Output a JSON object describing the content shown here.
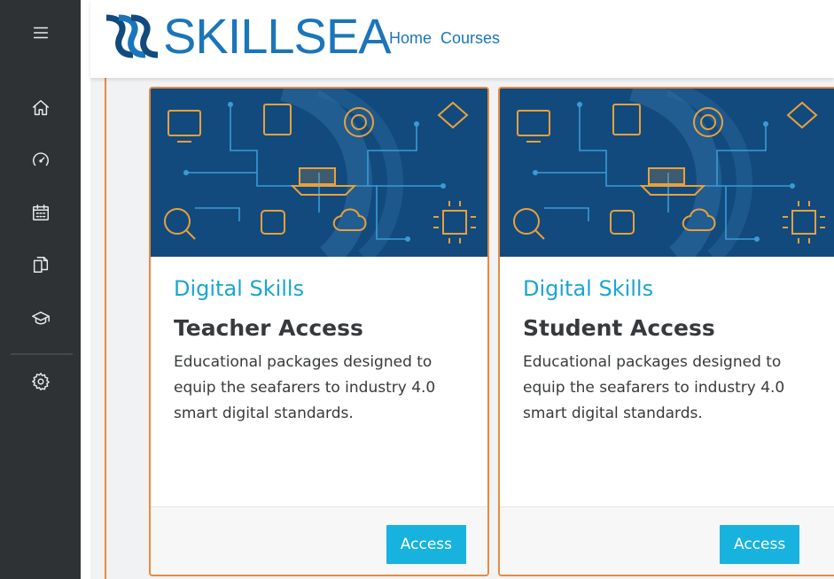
{
  "app": {
    "logo_text": "SKILLSEA",
    "brand_color": "#1b75bb",
    "accent_color": "#18b2de",
    "border_accent": "#e88a3e"
  },
  "nav": {
    "home": "Home",
    "courses": "Courses"
  },
  "rail": {
    "items": [
      {
        "icon": "menu-icon"
      },
      {
        "icon": "home-icon"
      },
      {
        "icon": "dashboard-icon"
      },
      {
        "icon": "calendar-icon"
      },
      {
        "icon": "files-icon"
      },
      {
        "icon": "graduation-cap-icon"
      },
      {
        "icon": "gear-icon"
      }
    ]
  },
  "cards": [
    {
      "subtitle": "Digital Skills",
      "title": "Teacher Access",
      "description": "Educational packages designed to equip the seafarers to industry 4.0 smart digital standards.",
      "button": "Access"
    },
    {
      "subtitle": "Digital Skills",
      "title": "Student Access",
      "description": "Educational packages designed to equip the seafarers to industry 4.0 smart digital standards.",
      "button": "Access"
    }
  ]
}
